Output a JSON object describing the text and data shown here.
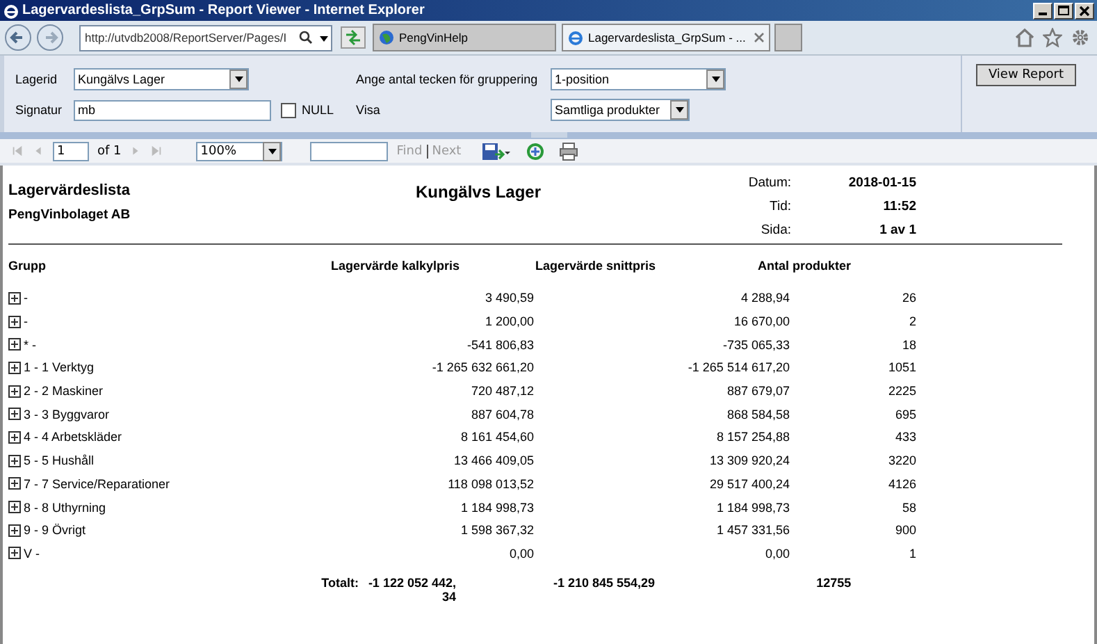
{
  "window": {
    "title": "Lagervardeslista_GrpSum - Report Viewer - Internet Explorer"
  },
  "browser": {
    "address": "http://utvdb2008/ReportServer/Pages/I",
    "tabs": [
      {
        "label": "PengVinHelp",
        "selected": false
      },
      {
        "label": "Lagervardeslista_GrpSum - ...",
        "selected": true
      }
    ]
  },
  "parameters": [
    {
      "label": "Lagerid",
      "kind": "select",
      "value": "Kungälvs Lager"
    },
    {
      "label": "Ange antal tecken för gruppering",
      "kind": "select",
      "value": "1-position"
    },
    {
      "label": "Signatur",
      "kind": "text",
      "value": "mb",
      "null_option": {
        "label": "NULL",
        "checked": false
      }
    },
    {
      "label": "Visa",
      "kind": "select",
      "value": "Samtliga produkter"
    }
  ],
  "view_button": "View Report",
  "toolbar": {
    "page": "1",
    "page_count": "of 1",
    "zoom": "100%",
    "find": "Find",
    "next": "Next",
    "find_disabled": true
  },
  "report": {
    "title": "Lagervärdeslista",
    "company": "PengVinbolaget AB",
    "subtitle": "Kungälvs Lager",
    "meta": [
      {
        "label": "Datum:",
        "value": "2018-01-15"
      },
      {
        "label": "Tid:",
        "value": "11:52"
      },
      {
        "label": "Sida:",
        "value": "1 av 1"
      }
    ],
    "columns": [
      "Grupp",
      "Lagervärde kalkylpris",
      "Lagervärde snittpris",
      "Antal produkter"
    ],
    "rows": [
      {
        "group": "-",
        "kalkylpris": "3 490,59",
        "snittpris": "4 288,94",
        "antal": "26",
        "expanded": false
      },
      {
        "group": "-",
        "kalkylpris": "1 200,00",
        "snittpris": "16 670,00",
        "antal": "2",
        "expanded": false
      },
      {
        "group": "* -",
        "kalkylpris": "-541 806,83",
        "snittpris": "-735 065,33",
        "antal": "18",
        "expanded": false
      },
      {
        "group": "1 - 1 Verktyg",
        "kalkylpris": "-1 265 632 661,20",
        "snittpris": "-1 265 514 617,20",
        "antal": "1051",
        "expanded": false
      },
      {
        "group": "2 - 2 Maskiner",
        "kalkylpris": "720 487,12",
        "snittpris": "887 679,07",
        "antal": "2225",
        "expanded": false
      },
      {
        "group": "3 - 3 Byggvaror",
        "kalkylpris": "887 604,78",
        "snittpris": "868 584,58",
        "antal": "695",
        "expanded": false
      },
      {
        "group": "4 - 4 Arbetskläder",
        "kalkylpris": "8 161 454,60",
        "snittpris": "8 157 254,88",
        "antal": "433",
        "expanded": false
      },
      {
        "group": "5 - 5 Hushåll",
        "kalkylpris": "13 466 409,05",
        "snittpris": "13 309 920,24",
        "antal": "3220",
        "expanded": false
      },
      {
        "group": "7 - 7 Service/Reparationer",
        "kalkylpris": "118 098 013,52",
        "snittpris": "29 517 400,24",
        "antal": "4126",
        "expanded": false
      },
      {
        "group": "8 - 8 Uthyrning",
        "kalkylpris": "1 184 998,73",
        "snittpris": "1 184 998,73",
        "antal": "58",
        "expanded": false
      },
      {
        "group": "9 - 9 Övrigt",
        "kalkylpris": "1 598 367,32",
        "snittpris": "1 457 331,56",
        "antal": "900",
        "expanded": false
      },
      {
        "group": "V -",
        "kalkylpris": "0,00",
        "snittpris": "0,00",
        "antal": "1",
        "expanded": false
      }
    ],
    "total": {
      "label": "Totalt:",
      "kalkylpris": "-1 122 052 442,34",
      "snittpris": "-1 210 845 554,29",
      "antal": "12755"
    }
  }
}
